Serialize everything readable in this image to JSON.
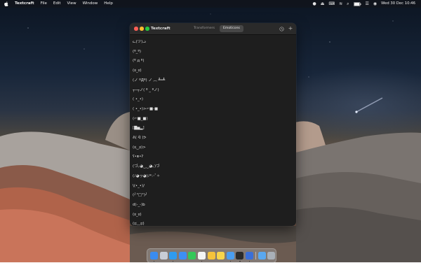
{
  "menubar": {
    "app_name": "Textcraft",
    "items": [
      "File",
      "Edit",
      "View",
      "Window",
      "Help"
    ],
    "clock": "Wed 30 Dec  10:46",
    "status_icons": [
      "menu-extra-icon",
      "control-icon",
      "keyboard-icon",
      "wifi-icon",
      "search-icon",
      "battery-icon",
      "control-center-icon",
      "siri-icon"
    ]
  },
  "window": {
    "title": "Textcraft",
    "tabs": [
      {
        "label": "Transformers",
        "active": false
      },
      {
        "label": "Emoticons",
        "active": true
      }
    ],
    "toolbar_icons": [
      "history-icon",
      "add-icon"
    ],
    "emoticons": [
      "ᓚ(ツ)ᓗ",
      "(º_º)",
      "(º д º)",
      "(ಠ_ಠ)",
      "(ノ ºДº) ノ ︵ ┻━┻",
      "┬─┬ノ( º _ ºノ)",
      "( •_•)",
      "( •_•)>⌐■-■",
      "(⌐■_■)",
      "[▇▅▂]",
      "ᕕ( ᐛ )ᕗ",
      "(ಠ‿ಠ)>",
      "ʕ•ᴥ•ʔ",
      "(づ｡◕‿‿◕｡)づ",
      "(ﾉ◕ヮ◕)ﾉ*:･ﾟ✧",
      "\\(•_•)/",
      "(╯°□°)╯",
      "d(-_-)b",
      "(ಠ_ಠ)",
      "(ಥ﹏ಥ)"
    ]
  },
  "dock": {
    "apps": [
      {
        "name": "finder-icon",
        "color": "#3b8cf0",
        "running": true
      },
      {
        "name": "launchpad-icon",
        "color": "#c8cdd6",
        "running": false
      },
      {
        "name": "safari-icon",
        "color": "#2f9bf0",
        "running": true
      },
      {
        "name": "mail-icon",
        "color": "#3d8ff5",
        "running": false
      },
      {
        "name": "messages-icon",
        "color": "#34c759",
        "running": false
      },
      {
        "name": "calendar-icon",
        "color": "#f4f4f4",
        "running": true
      },
      {
        "name": "photos-icon",
        "color": "#f5c33b",
        "running": false
      },
      {
        "name": "notes-icon",
        "color": "#f7d54b",
        "running": false
      },
      {
        "name": "xcode-icon",
        "color": "#4a9ef0",
        "running": true
      },
      {
        "name": "terminal-icon",
        "color": "#2b2b2b",
        "running": true
      },
      {
        "name": "instruments-icon",
        "color": "#3a6fd8",
        "running": true
      },
      {
        "name": "folder-icon",
        "color": "#5aa8f0",
        "running": false
      },
      {
        "name": "trash-icon",
        "color": "#a9b0b8",
        "running": false
      }
    ]
  }
}
